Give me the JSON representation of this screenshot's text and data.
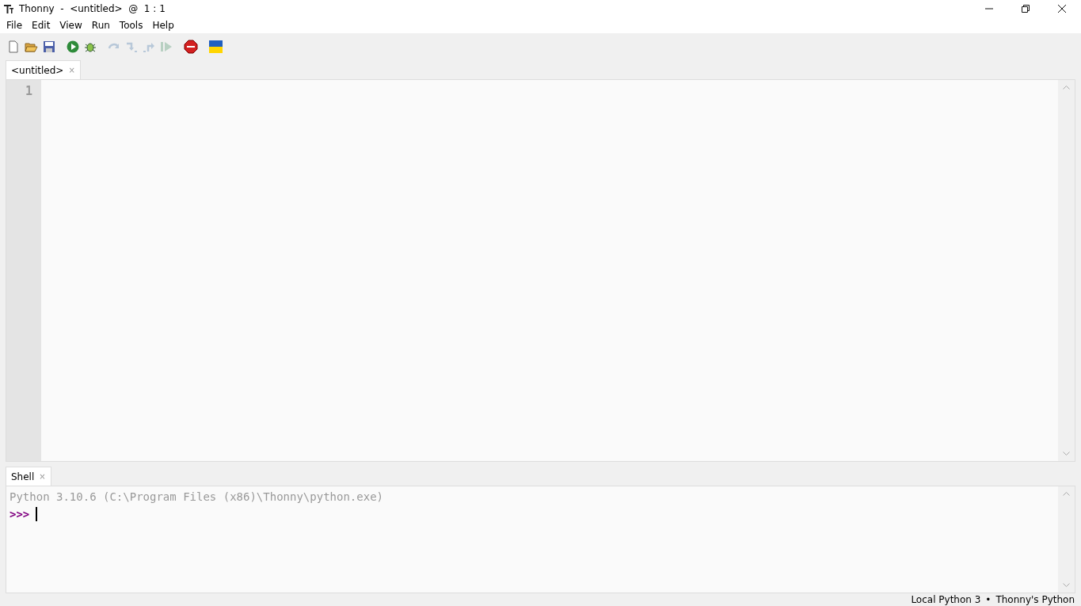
{
  "window": {
    "title": "Thonny  -  <untitled>  @  1 : 1"
  },
  "menu": [
    "File",
    "Edit",
    "View",
    "Run",
    "Tools",
    "Help"
  ],
  "toolbar": [
    {
      "kind": "new",
      "disabled": false
    },
    {
      "kind": "open",
      "disabled": false
    },
    {
      "kind": "save",
      "disabled": false
    },
    {
      "kind": "run",
      "disabled": false
    },
    {
      "kind": "debug",
      "disabled": false
    },
    {
      "kind": "step-over",
      "disabled": true
    },
    {
      "kind": "step-into",
      "disabled": true
    },
    {
      "kind": "step-out",
      "disabled": true
    },
    {
      "kind": "resume",
      "disabled": true
    },
    {
      "kind": "stop",
      "disabled": false
    },
    {
      "kind": "flag",
      "disabled": false
    }
  ],
  "editor": {
    "tabs": [
      {
        "label": "<untitled>",
        "close": "×",
        "selected": true
      }
    ],
    "line_numbers": [
      "1"
    ]
  },
  "shell": {
    "tabs": [
      {
        "label": "Shell",
        "close": "×",
        "selected": true
      }
    ],
    "banner": "Python 3.10.6 (C:\\Program Files (x86)\\Thonny\\python.exe)",
    "prompt": ">>>"
  },
  "status_bar": [
    "Local Python 3",
    "•",
    "Thonny's Python"
  ]
}
